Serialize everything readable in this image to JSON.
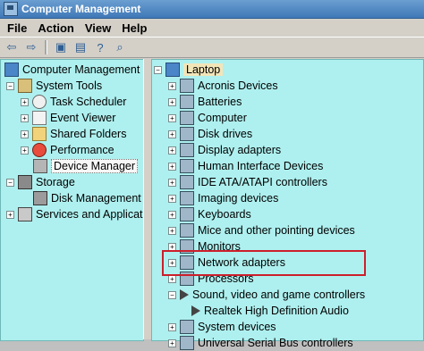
{
  "window": {
    "title": "Computer Management"
  },
  "menu": {
    "items": [
      "File",
      "Action",
      "View",
      "Help"
    ]
  },
  "toolbar": {
    "buttons": [
      "back-icon",
      "forward-icon",
      "up-icon",
      "properties-icon",
      "help-icon",
      "scan-icon"
    ]
  },
  "left_tree": {
    "root": "Computer Management (",
    "system_tools": "System Tools",
    "task_scheduler": "Task Scheduler",
    "event_viewer": "Event Viewer",
    "shared_folders": "Shared Folders",
    "performance": "Performance",
    "device_manager": "Device Manager",
    "storage": "Storage",
    "disk_management": "Disk Management",
    "services": "Services and Applicati"
  },
  "right_tree": {
    "root": "Laptop",
    "items": [
      "Acronis Devices",
      "Batteries",
      "Computer",
      "Disk drives",
      "Display adapters",
      "Human Interface Devices",
      "IDE ATA/ATAPI controllers",
      "Imaging devices",
      "Keyboards",
      "Mice and other pointing devices",
      "Monitors",
      "Network adapters",
      "Processors",
      "Sound, video and game controllers",
      "Realtek High Definition Audio",
      "System devices",
      "Universal Serial Bus controllers"
    ]
  }
}
